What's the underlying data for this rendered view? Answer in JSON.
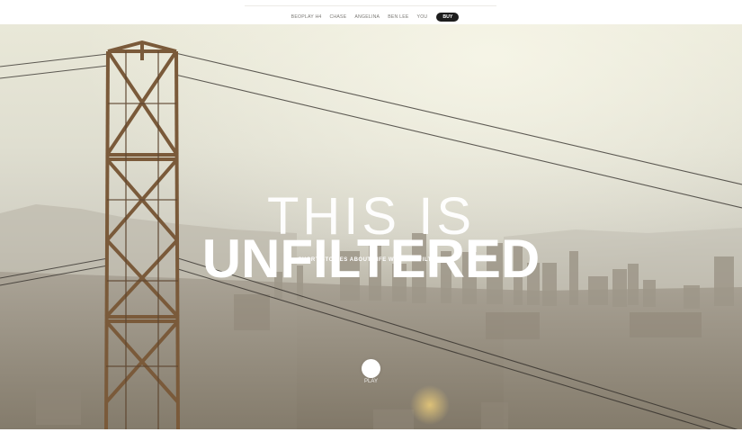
{
  "nav": {
    "items": [
      {
        "label": "BEOPLAY H4"
      },
      {
        "label": "CHASE"
      },
      {
        "label": "ANGELINA"
      },
      {
        "label": "BEN LEE"
      },
      {
        "label": "YOU"
      }
    ],
    "buy_label": "BUY"
  },
  "hero": {
    "title_line1": "THIS IS",
    "title_line2": "UNFILTERED",
    "tagline": "SHORT STORIES ABOUT LIFE WITHOUT FILTERS",
    "play_label": "PLAY"
  },
  "colors": {
    "sky": "#e9e8d8",
    "haze": "#d1cfc3",
    "city": "#9d9584",
    "tower": "#7a5a3a",
    "button_dark": "#1d1d1d",
    "text_white": "#ffffff"
  },
  "icons": {
    "play": "play-circle-icon"
  }
}
